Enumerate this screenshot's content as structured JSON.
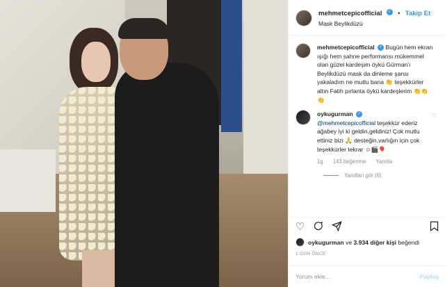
{
  "header": {
    "username": "mehmetcepicofficial",
    "separator": "•",
    "follow_label": "Takip Et",
    "location": "Mask Beylikdüzü"
  },
  "caption": {
    "username": "mehmetcepicofficial",
    "text": "Bugün hem ekran ışığı hem sahne performansı mükemmel olan güzel kardeşim öykü Gürman'ı Beylikdüzü mask da dinleme şansı yakaladım ne mutlu bana 👏 teşekkürler altın Fatih pırlanta öykü kardeşlerim 👏👏👏"
  },
  "comment": {
    "username": "oykugurman",
    "mention": "@mehmetcepicofficial",
    "text": " teşekkür ederiz ağabey iyi ki geldin,geldiniz! Çok mutlu ettiniz bizi 🙏 desteğin,varlığın için çok teşekkürler tekrar ☺🎬🎈",
    "age": "1g",
    "likes": "143 beğenme",
    "reply_label": "Yanıtla",
    "view_replies": "Yanıtları gör (6)"
  },
  "likes": {
    "user": "oykugurman",
    "joiner": " ve ",
    "others": "3.934 diğer kişi",
    "suffix": " beğendi"
  },
  "timestamp": "1 GÜN ÖNCE",
  "add_comment": {
    "placeholder": "Yorum ekle...",
    "post_label": "Paylaş"
  },
  "icons": {
    "heart": "heart-icon",
    "comment": "comment-icon",
    "share": "share-icon",
    "save": "bookmark-icon"
  }
}
